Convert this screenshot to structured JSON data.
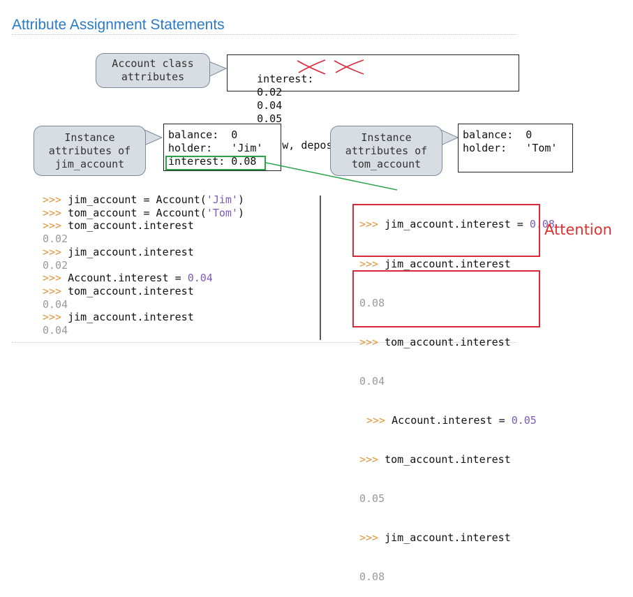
{
  "title": "Attribute Assignment Statements",
  "class_callout": {
    "line1": "Account class",
    "line2": "attributes"
  },
  "class_box": {
    "interest_label": "interest:",
    "old1": "0.02",
    "old2": "0.04",
    "current": "0.05",
    "methods": "(withdraw, deposit, __init__)"
  },
  "jim_callout": {
    "line1": "Instance",
    "line2": "attributes of",
    "line3": "jim_account"
  },
  "jim_box": {
    "row1": "balance:  0",
    "row2": "holder:   'Jim'",
    "row3": "interest: 0.08"
  },
  "tom_callout": {
    "line1": "Instance",
    "line2": "attributes of",
    "line3": "tom_account"
  },
  "tom_box": {
    "row1": "balance:  0",
    "row2": "holder:   'Tom'"
  },
  "prompt": ">>>",
  "left_code": [
    {
      "pre": " jim_account = Account(",
      "str": "'Jim'",
      "post": ")"
    },
    {
      "pre": " tom_account = Account(",
      "str": "'Tom'",
      "post": ")"
    },
    {
      "pre": " tom_account.interest"
    },
    {
      "out": "0.02"
    },
    {
      "pre": " jim_account.interest"
    },
    {
      "out": "0.02"
    },
    {
      "pre": " Account.interest = ",
      "num": "0.04"
    },
    {
      "pre": " tom_account.interest"
    },
    {
      "out": "0.04"
    },
    {
      "pre": " jim_account.interest"
    },
    {
      "out": "0.04"
    }
  ],
  "right_code": {
    "l1_pre": " jim_account.interest = ",
    "l1_num": "0.08",
    "l2": " jim_account.interest",
    "l3": "0.08",
    "l4": " tom_account.interest",
    "l5": "0.04",
    "l6_pre": " Account.interest = ",
    "l6_num": "0.05",
    "l7": " tom_account.interest",
    "l8": "0.05",
    "l9": " jim_account.interest",
    "l10": "0.08"
  },
  "attention": "Attention",
  "colors": {
    "title": "#2b7bc4",
    "prompt": "#e0953a",
    "highlight_red": "#d62b3a",
    "highlight_green": "#2aa34a"
  }
}
